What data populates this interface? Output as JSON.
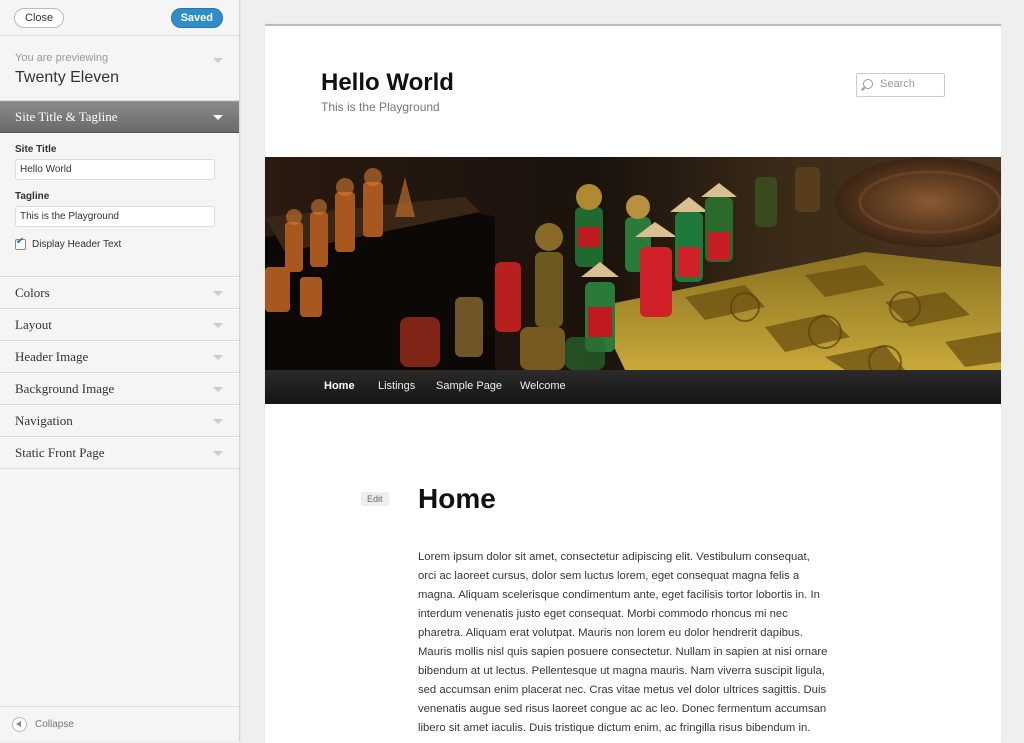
{
  "sidebar": {
    "close_label": "Close",
    "saved_label": "Saved",
    "previewing_label": "You are previewing",
    "theme_name": "Twenty Eleven",
    "active_section": {
      "title": "Site Title & Tagline",
      "site_title_label": "Site Title",
      "site_title_value": "Hello World",
      "tagline_label": "Tagline",
      "tagline_value": "This is the Playground",
      "display_header_text_label": "Display Header Text",
      "display_header_text_checked": true
    },
    "sections": [
      "Colors",
      "Layout",
      "Header Image",
      "Background Image",
      "Navigation",
      "Static Front Page"
    ],
    "collapse_label": "Collapse"
  },
  "preview": {
    "site_title": "Hello World",
    "site_tagline": "This is the Playground",
    "search_placeholder": "Search",
    "nav": [
      "Home",
      "Listings",
      "Sample Page",
      "Welcome"
    ],
    "current_nav": "Home",
    "edit_label": "Edit",
    "page_title": "Home",
    "content_lines": [
      "Lorem ipsum dolor sit amet, consectetur adipiscing elit. Vestibulum consequat,",
      "orci ac laoreet cursus, dolor sem luctus lorem, eget consequat magna felis a",
      "magna. Aliquam scelerisque condimentum ante, eget facilisis tortor lobortis in. In",
      "interdum venenatis justo eget consequat. Morbi commodo rhoncus mi nec",
      "pharetra. Aliquam erat volutpat. Mauris non lorem eu dolor hendrerit dapibus.",
      "Mauris mollis nisl quis sapien posuere consectetur. Nullam in sapien at nisi ornare",
      "bibendum at ut lectus. Pellentesque ut magna mauris. Nam viverra suscipit ligula,",
      "sed accumsan enim placerat nec. Cras vitae metus vel dolor ultrices sagittis. Duis",
      "venenatis augue sed risus laoreet congue ac ac leo. Donec fermentum accumsan",
      "libero sit amet iaculis. Duis tristique dictum enim, ac fringilla risus bibendum in."
    ]
  },
  "colors": {
    "saved_blue": "#2e8ecb",
    "active_section_bg": "#777777",
    "nav_bar_bg": "#1a1a1a"
  }
}
